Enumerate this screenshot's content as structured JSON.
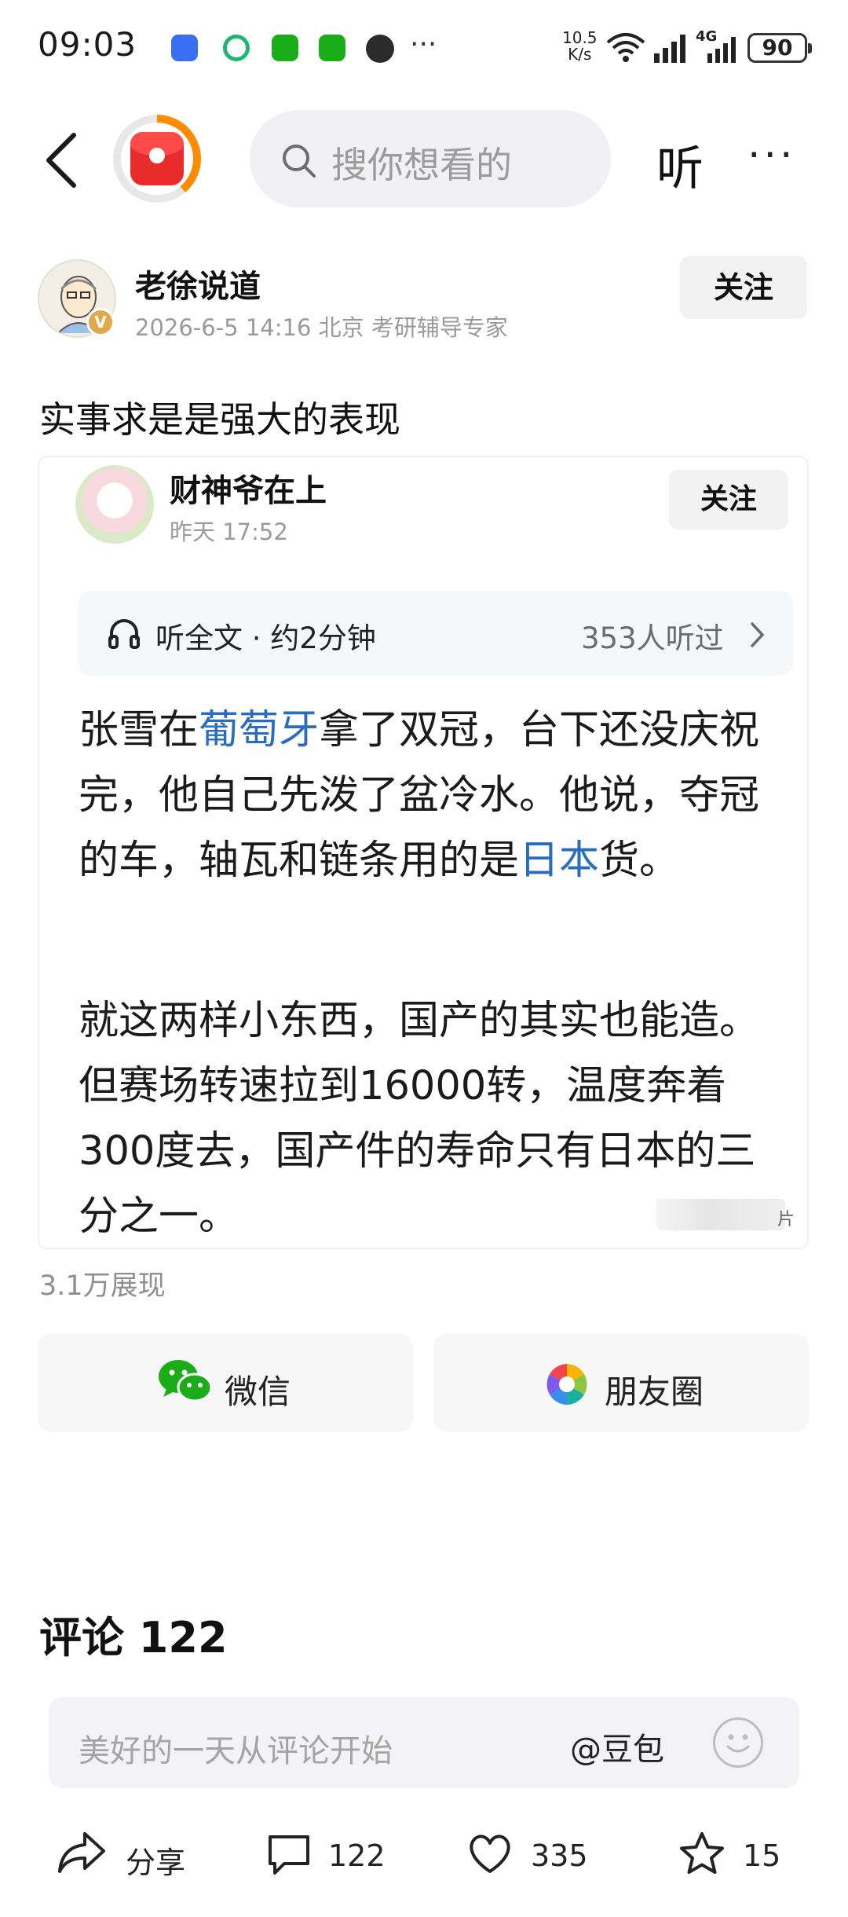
{
  "status_bar": {
    "time": "09:03",
    "net_speed_top": "10.5",
    "net_speed_bottom": "K/s",
    "network_type": "4G",
    "battery": "90"
  },
  "header": {
    "search_placeholder": "搜你想看的",
    "listen_label": "听"
  },
  "author": {
    "name": "老徐说道",
    "meta": "2026-6-5 14:16 北京 考研辅导专家",
    "badge": "V",
    "follow_label": "关注"
  },
  "post": {
    "title": "实事求是是强大的表现",
    "views": "3.1万展现"
  },
  "quoted": {
    "author": "财神爷在上",
    "time": "昨天  17:52",
    "follow_label": "关注",
    "audio_label": "听全文 · 约2分钟",
    "audio_count": "353人听过",
    "paragraph1": {
      "t1": "张雪在",
      "link1": "葡萄牙",
      "t2": "拿了双冠，台下还没庆祝完，他自己先泼了盆冷水。他说，夺冠的车，轴瓦和链条用的是",
      "link2": "日本",
      "t3": "货。"
    },
    "paragraph2": "就这两样小东西，国产的其实也能造。但赛场转速拉到16000转，温度奔着300度去，国产件的寿命只有日本的三分之一。",
    "truncated_tail": "片"
  },
  "share": {
    "wechat": "微信",
    "moments": "朋友圈"
  },
  "comments": {
    "title": "评论 122",
    "placeholder": "美好的一天从评论开始",
    "doubao": "@豆包"
  },
  "bottom_bar": {
    "share": "分享",
    "comments": "122",
    "likes": "335",
    "favorites": "15"
  },
  "colors": {
    "link": "#2a6dbd",
    "red_packet": "#ea2b2b",
    "progress_ring": "#ff8c00",
    "wechat_green": "#1aad19"
  },
  "icons": [
    "back-icon",
    "red-packet-icon",
    "search-icon",
    "more-icon",
    "headphones-icon",
    "chevron-right-icon",
    "wechat-icon",
    "moments-icon",
    "smiley-icon",
    "share-icon",
    "comment-icon",
    "heart-icon",
    "star-icon"
  ]
}
